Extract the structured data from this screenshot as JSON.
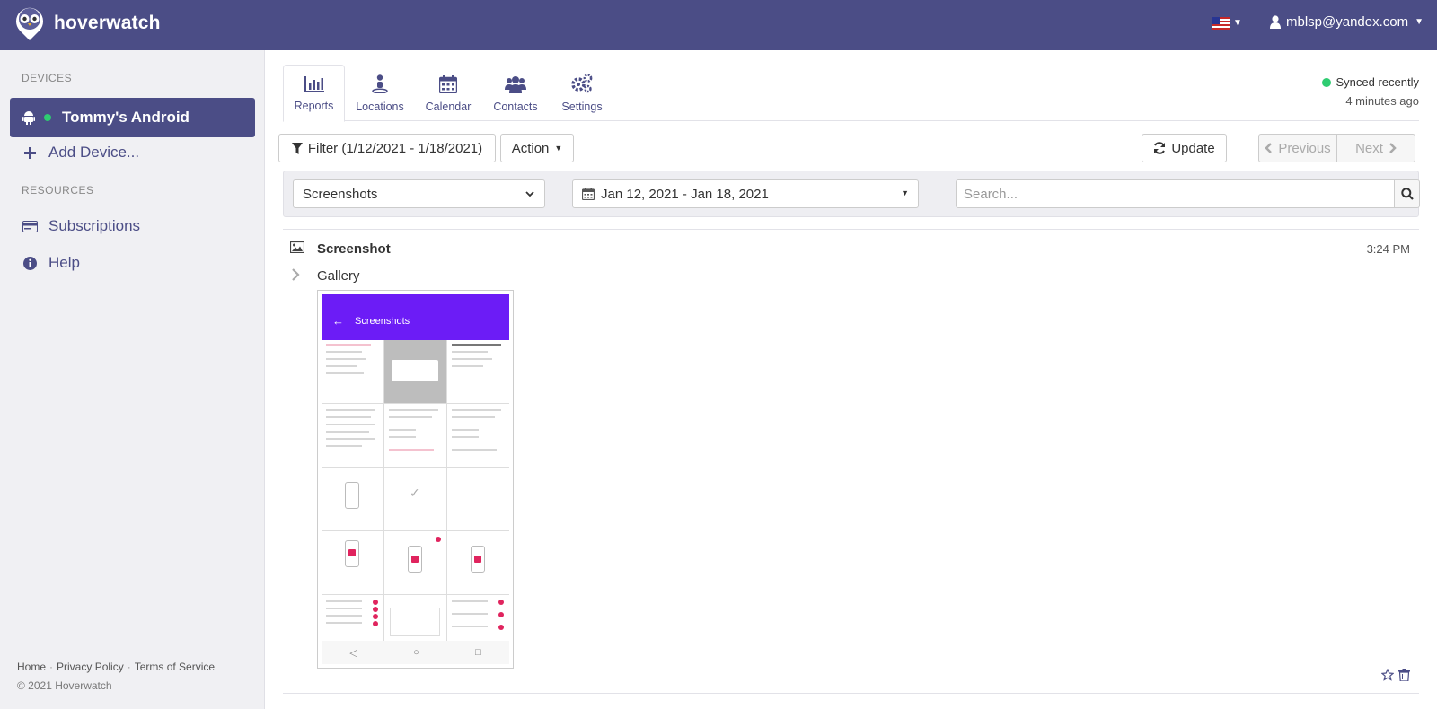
{
  "app": {
    "brand": "hoverwatch",
    "user_email": "mblsp@yandex.com",
    "accent": "#4b4d86",
    "online": "#2ecc71"
  },
  "sidebar": {
    "devices_title": "DEVICES",
    "device": "Tommy's Android",
    "add_device": "Add Device...",
    "resources_title": "RESOURCES",
    "subscriptions": "Subscriptions",
    "help": "Help",
    "footer": {
      "home": "Home",
      "privacy": "Privacy Policy",
      "terms": "Terms of Service",
      "copyright": "© 2021 Hoverwatch"
    }
  },
  "tabs": {
    "reports": "Reports",
    "locations": "Locations",
    "calendar": "Calendar",
    "contacts": "Contacts",
    "settings": "Settings"
  },
  "sync": {
    "status": "Synced recently",
    "ago": "4 minutes ago"
  },
  "toolbar": {
    "filter": "Filter (1/12/2021 - 1/18/2021)",
    "action": "Action",
    "update": "Update",
    "previous": "Previous",
    "next": "Next"
  },
  "filters": {
    "type": "Screenshots",
    "date_range": "Jan 12, 2021 - Jan 18, 2021",
    "search_placeholder": "Search..."
  },
  "entry": {
    "title": "Screenshot",
    "time": "3:24 PM",
    "group": "Gallery",
    "thumbnail": {
      "app_title": "Screenshots",
      "app_bar_color": "#6c1cf6"
    }
  }
}
